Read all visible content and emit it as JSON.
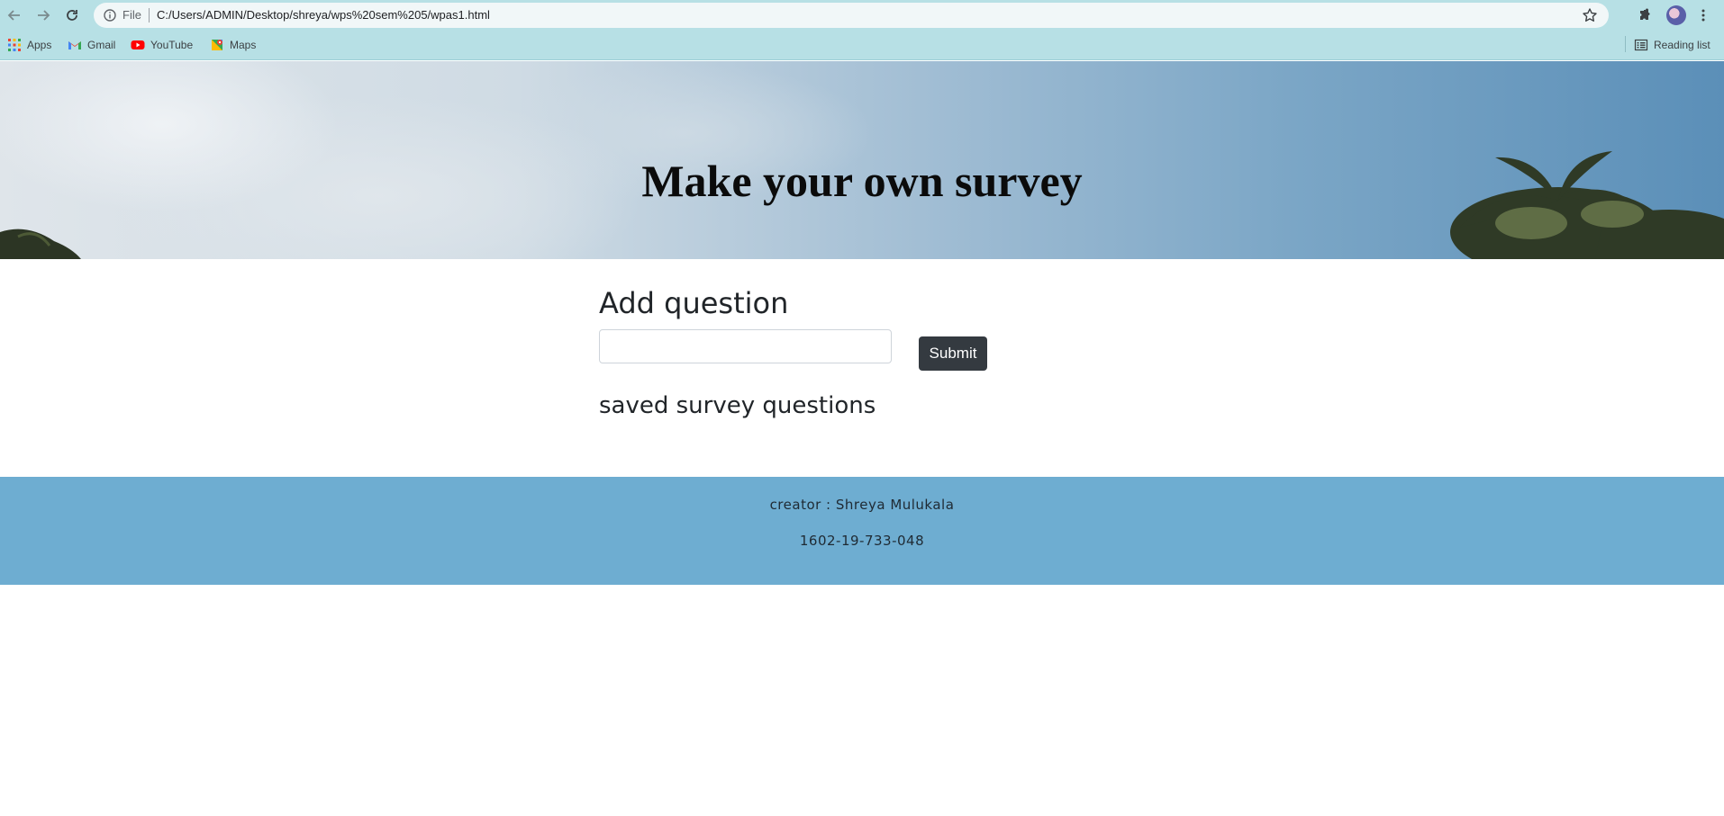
{
  "browser": {
    "url_scheme_label": "File",
    "url": "C:/Users/ADMIN/Desktop/shreya/wps%20sem%205/wpas1.html",
    "bookmarks": [
      {
        "label": "Apps",
        "icon": "apps-grid-icon"
      },
      {
        "label": "Gmail",
        "icon": "gmail-icon"
      },
      {
        "label": "YouTube",
        "icon": "youtube-icon"
      },
      {
        "label": "Maps",
        "icon": "maps-icon"
      }
    ],
    "reading_list_label": "Reading list"
  },
  "hero": {
    "title": "Make your own survey"
  },
  "form": {
    "heading": "Add question",
    "input_value": "",
    "submit_label": "Submit",
    "saved_heading": "saved survey questions"
  },
  "footer": {
    "creator": "creator : Shreya Mulukala",
    "id": "1602-19-733-048"
  },
  "colors": {
    "chrome": "#b7e0e5",
    "footer": "#6eadd1",
    "button": "#343a40"
  }
}
